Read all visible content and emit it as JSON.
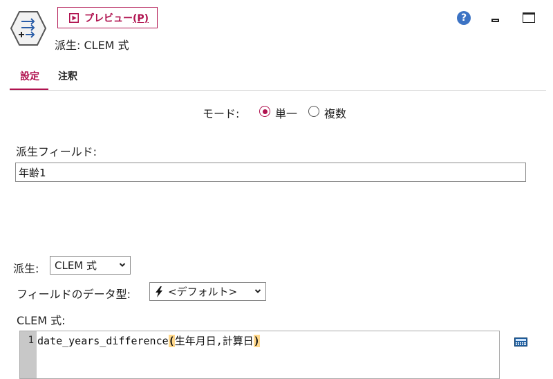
{
  "header": {
    "preview_label": "プレビュー",
    "preview_shortcut": "(P)",
    "node_title": "派生: CLEM 式",
    "help_label": "?"
  },
  "tabs": [
    {
      "label": "設定",
      "active": true
    },
    {
      "label": "注釈",
      "active": false
    }
  ],
  "mode": {
    "label": "モード:",
    "options": [
      {
        "label": "単一",
        "checked": true
      },
      {
        "label": "複数",
        "checked": false
      }
    ]
  },
  "derive_field": {
    "label": "派生フィールド:",
    "value": "年齢1"
  },
  "derive_as": {
    "label": "派生:",
    "selected": "CLEM 式"
  },
  "field_type": {
    "label": "フィールドのデータ型:",
    "selected": "<デフォルト>"
  },
  "clem": {
    "label": "CLEM 式:",
    "line_number": "1",
    "func": "date_years_difference",
    "open_paren": "(",
    "args": "生年月日,計算日",
    "close_paren": ")"
  },
  "colors": {
    "accent": "#b0124f",
    "help": "#3c73c4",
    "paren_highlight": "#ffd88c",
    "gutter": "#c8c8c8"
  },
  "icons": [
    "derive-node-icon",
    "play-icon",
    "help-icon",
    "minimize-icon",
    "maximize-icon",
    "chevron-down-icon",
    "lightning-icon",
    "calculator-icon"
  ]
}
